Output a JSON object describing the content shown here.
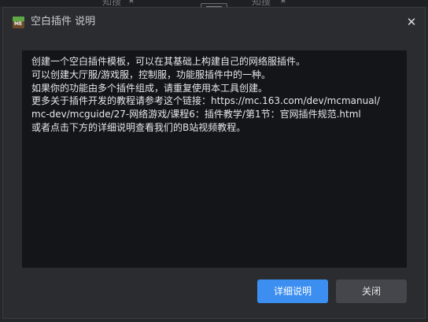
{
  "background": {
    "partial_labels": [
      "知搜",
      "知搜"
    ]
  },
  "dialog": {
    "title": "空白插件 说明",
    "icon_label": "ME",
    "content_lines": [
      "创建一个空白插件模板，可以在其基础上构建自己的网络服插件。",
      "可以创建大厅服/游戏服，控制服，功能服插件中的一种。",
      "如果你的功能由多个插件组成，请重复使用本工具创建。",
      "更多关于插件开发的教程请参考这个链接：https://mc.163.com/dev/mcmanual/",
      "mc-dev/mcguide/27-网络游戏/课程6：插件教学/第1节：官网插件规范.html",
      "或者点击下方的详细说明查看我们的B站视频教程。"
    ],
    "buttons": {
      "details": "详细说明",
      "close": "关闭"
    }
  },
  "colors": {
    "primary": "#3c8ff0",
    "secondary": "#45464b",
    "dialog_bg": "#2b2c30",
    "content_bg": "#141518"
  }
}
